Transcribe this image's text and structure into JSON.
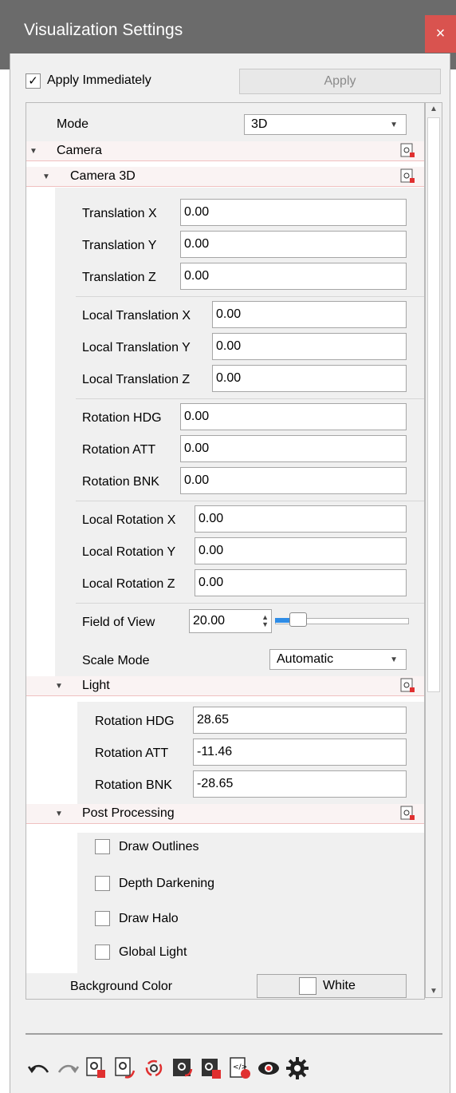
{
  "window": {
    "title": "Visualization Settings",
    "close": "×"
  },
  "apply_immediately": {
    "label": "Apply Immediately",
    "checked": true,
    "mark": "✓"
  },
  "apply_button": "Apply",
  "mode": {
    "label": "Mode",
    "value": "3D"
  },
  "camera": {
    "label": "Camera",
    "camera3d": {
      "label": "Camera 3D",
      "translation_x": {
        "label": "Translation X",
        "value": "0.00"
      },
      "translation_y": {
        "label": "Translation Y",
        "value": "0.00"
      },
      "translation_z": {
        "label": "Translation Z",
        "value": "0.00"
      },
      "local_translation_x": {
        "label": "Local Translation X",
        "value": "0.00"
      },
      "local_translation_y": {
        "label": "Local Translation Y",
        "value": "0.00"
      },
      "local_translation_z": {
        "label": "Local Translation Z",
        "value": "0.00"
      },
      "rotation_hdg": {
        "label": "Rotation HDG",
        "value": "0.00"
      },
      "rotation_att": {
        "label": "Rotation ATT",
        "value": "0.00"
      },
      "rotation_bnk": {
        "label": "Rotation BNK",
        "value": "0.00"
      },
      "local_rotation_x": {
        "label": "Local Rotation X",
        "value": "0.00"
      },
      "local_rotation_y": {
        "label": "Local Rotation Y",
        "value": "0.00"
      },
      "local_rotation_z": {
        "label": "Local Rotation Z",
        "value": "0.00"
      },
      "field_of_view": {
        "label": "Field of View",
        "value": "20.00"
      },
      "scale_mode": {
        "label": "Scale Mode",
        "value": "Automatic"
      }
    }
  },
  "light": {
    "label": "Light",
    "rotation_hdg": {
      "label": "Rotation HDG",
      "value": "28.65"
    },
    "rotation_att": {
      "label": "Rotation ATT",
      "value": "-11.46"
    },
    "rotation_bnk": {
      "label": "Rotation BNK",
      "value": "-28.65"
    }
  },
  "post_processing": {
    "label": "Post Processing",
    "draw_outlines": "Draw Outlines",
    "depth_darkening": "Depth Darkening",
    "draw_halo": "Draw Halo",
    "global_light": "Global Light"
  },
  "background_color": {
    "label": "Background Color",
    "value": "White"
  },
  "colors": {
    "titlebar": "#6b6b6b",
    "close": "#d9534f",
    "accent": "#2e8ce6"
  },
  "toolbar_icons": [
    "undo-icon",
    "redo-icon",
    "reset-camera-icon",
    "reset-camera-3d-icon",
    "sync-camera-icon",
    "save-settings-icon",
    "load-settings-icon",
    "export-code-icon",
    "visibility-icon",
    "settings-gear-icon"
  ]
}
